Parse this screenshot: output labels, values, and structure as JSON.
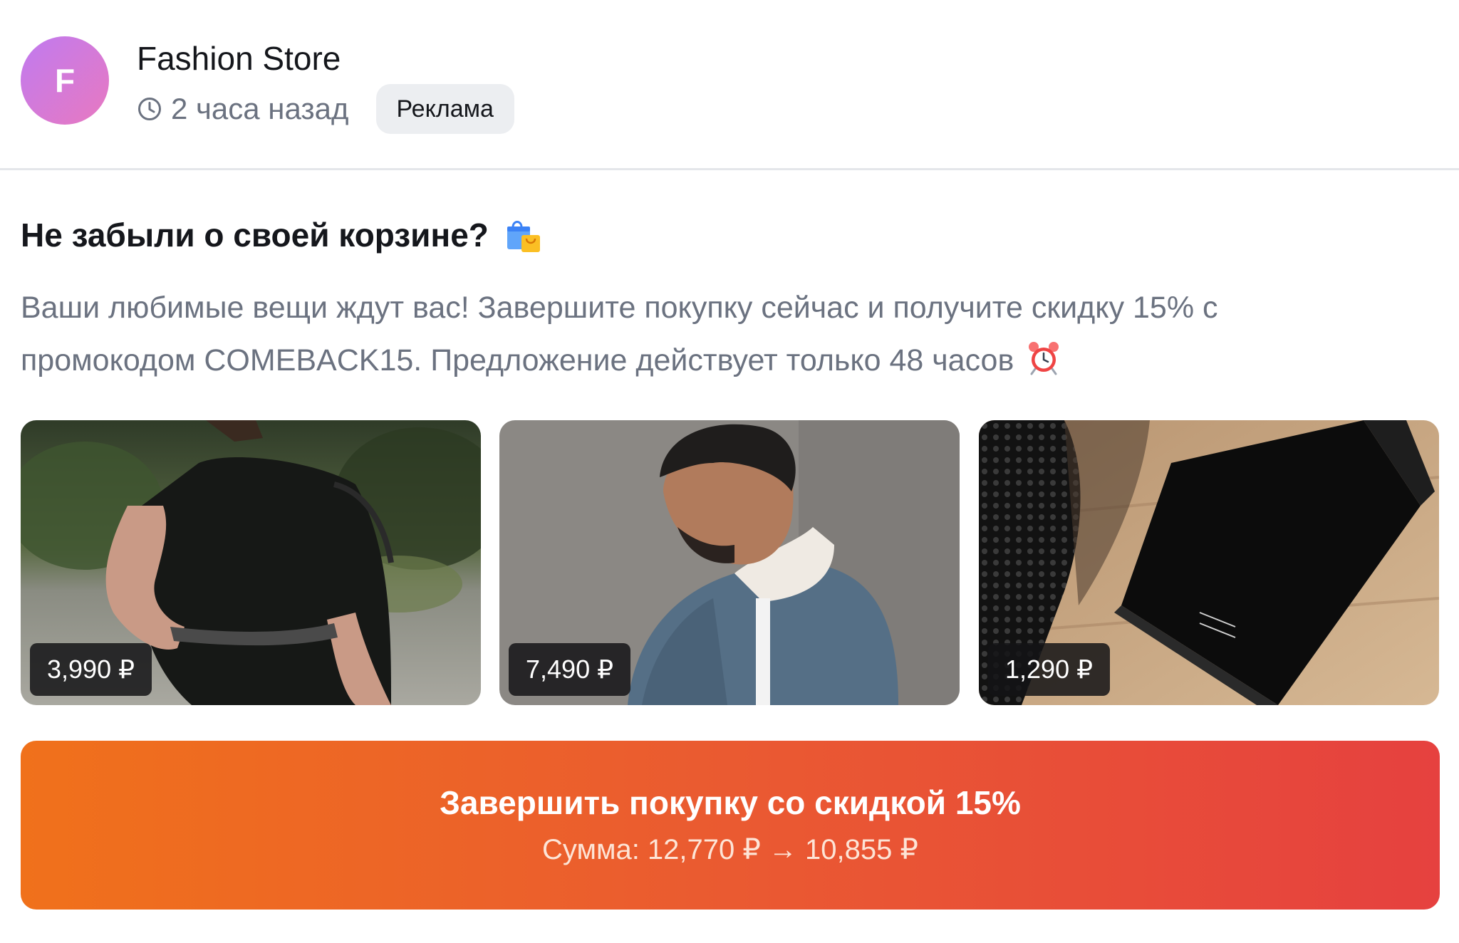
{
  "header": {
    "avatar_letter": "F",
    "store_name": "Fashion Store",
    "time_ago": "2 часа назад",
    "ad_label": "Реклама",
    "icon": "clock-icon"
  },
  "post": {
    "headline": "Не забыли о своей корзине?",
    "headline_icon": "shopping-bags-icon",
    "description_line1": "Ваши любимые вещи ждут вас! Завершите покупку сейчас и получите скидку 15% с",
    "description_line2": "промокодом COMEBACK15. Предложение действует только 48 часов",
    "description_icon": "alarm-clock-icon"
  },
  "products": [
    {
      "price": "3,990 ₽",
      "image": "black-dress-photo"
    },
    {
      "price": "7,490 ₽",
      "image": "denim-jacket-photo"
    },
    {
      "price": "1,290 ₽",
      "image": "black-wallet-photo"
    }
  ],
  "cta": {
    "title": "Завершить покупку со скидкой 15%",
    "subtitle": "Сумма: 12,770 ₽ → 10,855 ₽"
  },
  "colors": {
    "accent_start": "#f0711b",
    "accent_end": "#e6413f",
    "avatar_start": "#c07af0",
    "avatar_end": "#e879c0",
    "text_primary": "#15171c",
    "text_muted": "#6b7280",
    "badge_bg": "#eceef1"
  }
}
